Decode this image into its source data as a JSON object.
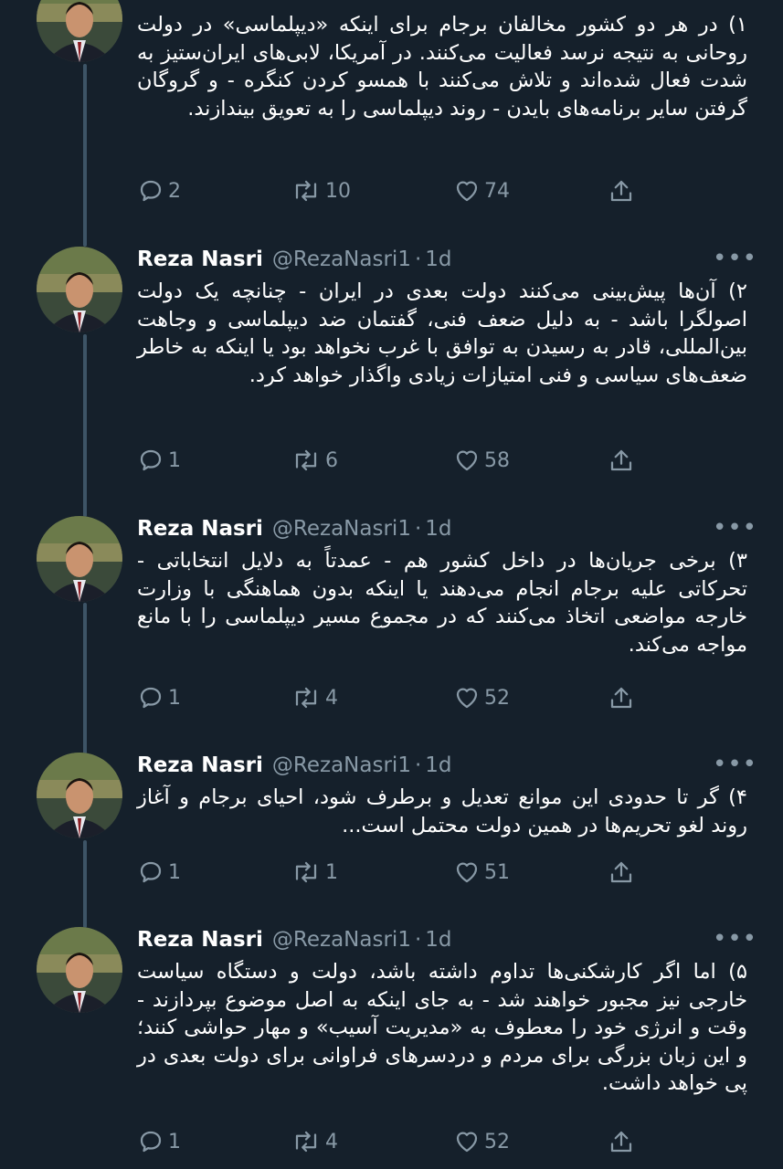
{
  "theme": {
    "background": "#15202b",
    "text": "#ffffff",
    "muted": "#8899a6",
    "thread_line": "#3d5466"
  },
  "tweets": [
    {
      "name": "",
      "handle": "",
      "time": "",
      "text": "۱) در هر دو کشور مخالفان برجام برای اینکه «دیپلماسی» در دولت روحانی به نتیجه نرسد فعالیت می‌کنند. در آمریکا، لابی‌های ایران‌ستیز به شدت فعال شده‌اند و تلاش می‌کنند با همسو کردن کنگره - و گروگان گرفتن سایر برنامه‌های بایدن - روند دیپلماسی را به تعویق بیندازند.",
      "replies": "2",
      "retweets": "10",
      "likes": "74"
    },
    {
      "name": "Reza Nasri",
      "handle": "@RezaNasri1",
      "time": "1d",
      "text": "۲) آن‌ها پیش‌بینی می‌کنند دولت بعدی در ایران - چنانچه یک دولت اصولگرا باشد - به دلیل ضعف فنی، گفتمان ضد دیپلماسی و وجاهت بین‌المللی، قادر به رسیدن به توافق با غرب نخواهد بود یا اینکه به خاطر ضعف‌های سیاسی و فنی امتیازات زیادی واگذار خواهد کرد.",
      "replies": "1",
      "retweets": "6",
      "likes": "58"
    },
    {
      "name": "Reza Nasri",
      "handle": "@RezaNasri1",
      "time": "1d",
      "text": "۳) برخی جریان‌ها در داخل کشور هم - عمدتاً به دلایل انتخاباتی - تحرکاتی علیه برجام انجام می‌دهند یا اینکه بدون هماهنگی با وزارت خارجه مواضعی اتخاذ می‌کنند که در مجموع مسیر دیپلماسی را با مانع مواجه می‌کند.",
      "replies": "1",
      "retweets": "4",
      "likes": "52"
    },
    {
      "name": "Reza Nasri",
      "handle": "@RezaNasri1",
      "time": "1d",
      "text": "۴) گر تا حدودی این موانع تعدیل و برطرف شود، احیای برجام و آغاز روند لغو تحریم‌ها در همین دولت محتمل است...",
      "replies": "1",
      "retweets": "1",
      "likes": "51"
    },
    {
      "name": "Reza Nasri",
      "handle": "@RezaNasri1",
      "time": "1d",
      "text": "۵) اما اگر کارشکنی‌ها تداوم داشته باشد، دولت و دستگاه سیاست خارجی نیز مجبور خواهند شد - به جای اینکه به اصل موضوع بپردازند - وقت و انرژی خود را معطوف به «مدیریت آسیب» و مهار حواشی کنند؛ و این زبان بزرگی برای مردم و دردسرهای فراوانی برای دولت بعدی در پی خواهد داشت.",
      "replies": "1",
      "retweets": "4",
      "likes": "52"
    }
  ],
  "icons": {
    "reply": "reply-icon",
    "retweet": "retweet-icon",
    "like": "heart-icon",
    "share": "share-icon",
    "more": "more-options-icon"
  },
  "separator": "·",
  "more_label": "•••"
}
